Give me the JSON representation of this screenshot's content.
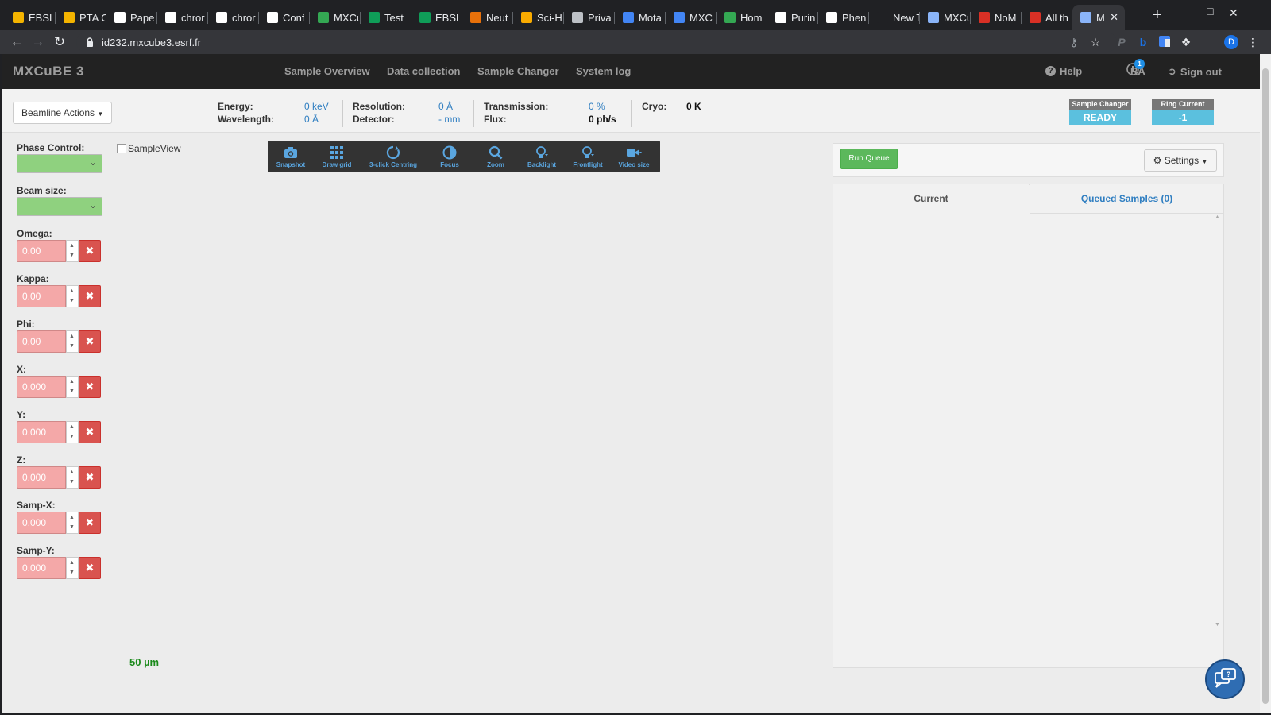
{
  "browser": {
    "tabs": [
      {
        "title": "EBSL",
        "favicon_color": "#f4b400"
      },
      {
        "title": "PTA C",
        "favicon_color": "#f4b400"
      },
      {
        "title": "Pape",
        "favicon_color": "#ffffff"
      },
      {
        "title": "chror",
        "favicon_color": "#ffffff"
      },
      {
        "title": "chror",
        "favicon_color": "#ffffff"
      },
      {
        "title": "Conf",
        "favicon_color": "#ffffff"
      },
      {
        "title": "MXCu",
        "favicon_color": "#34a853"
      },
      {
        "title": "Test",
        "favicon_color": "#0f9d58"
      },
      {
        "title": "EBSL",
        "favicon_color": "#0f9d58"
      },
      {
        "title": "Neut",
        "favicon_color": "#e8710a"
      },
      {
        "title": "Sci-H",
        "favicon_color": "#f9ab00"
      },
      {
        "title": "Priva",
        "favicon_color": "#bdc1c6"
      },
      {
        "title": "Mota",
        "favicon_color": "#4285f4"
      },
      {
        "title": "MXC",
        "favicon_color": "#4285f4"
      },
      {
        "title": "Hom",
        "favicon_color": "#34a853"
      },
      {
        "title": "Purin",
        "favicon_color": "#ffffff"
      },
      {
        "title": "Phen",
        "favicon_color": "#ffffff"
      },
      {
        "title": "New Tab",
        "favicon_color": "#202124"
      },
      {
        "title": "MXCu",
        "favicon_color": "#8ab4f8"
      },
      {
        "title": "NoM",
        "favicon_color": "#d93025"
      },
      {
        "title": "All th",
        "favicon_color": "#d93025"
      },
      {
        "title": "M",
        "favicon_color": "#8ab4f8"
      }
    ],
    "url": "id232.mxcube3.esrf.fr",
    "profile_initial": "D"
  },
  "navbar": {
    "brand": "MXCuBE 3",
    "links": [
      "Sample Overview",
      "Data collection",
      "Sample Changer",
      "System log"
    ],
    "help": "Help",
    "notifications_count": "1",
    "user": "RA",
    "sign_out": "Sign out"
  },
  "status": {
    "beamline_actions": "Beamline Actions",
    "energy_label": "Energy:",
    "energy_value": "0 keV",
    "wavelength_label": "Wavelength:",
    "wavelength_value": "0 Å",
    "resolution_label": "Resolution:",
    "resolution_value": "0 Å",
    "detector_label": "Detector:",
    "detector_value": "- mm",
    "transmission_label": "Transmission:",
    "transmission_value": "0 %",
    "flux_label": "Flux:",
    "flux_value": "0 ph/s",
    "cryo_label": "Cryo:",
    "cryo_value": "0 K",
    "sample_changer_label": "Sample Changer",
    "sample_changer_value": "READY",
    "sample_changer_color": "#5bc0de",
    "ring_current_label": "Ring Current",
    "ring_current_value": "-1",
    "ring_current_color": "#5bc0de"
  },
  "controls": {
    "phase_control_label": "Phase Control:",
    "beam_size_label": "Beam size:",
    "motors": [
      {
        "label": "Omega:",
        "value": "0.00"
      },
      {
        "label": "Kappa:",
        "value": "0.00"
      },
      {
        "label": "Phi:",
        "value": "0.00"
      },
      {
        "label": "X:",
        "value": "0.000"
      },
      {
        "label": "Y:",
        "value": "0.000"
      },
      {
        "label": "Z:",
        "value": "0.000"
      },
      {
        "label": "Samp-X:",
        "value": "0.000"
      },
      {
        "label": "Samp-Y:",
        "value": "0.000"
      }
    ]
  },
  "sample_view": {
    "image_alt": "SampleView",
    "toolbar": [
      {
        "label": "Snapshot",
        "icon": "camera-icon"
      },
      {
        "label": "Draw grid",
        "icon": "grid-icon"
      },
      {
        "label": "3-click Centring",
        "icon": "circle-icon"
      },
      {
        "label": "Focus",
        "icon": "contrast-icon"
      },
      {
        "label": "Zoom",
        "icon": "zoom-icon"
      },
      {
        "label": "Backlight",
        "icon": "lightbulb-icon"
      },
      {
        "label": "Frontlight",
        "icon": "lightbulb-icon"
      },
      {
        "label": "Video size",
        "icon": "video-icon"
      }
    ],
    "scale_label": "50 µm"
  },
  "queue": {
    "run_queue": "Run Queue",
    "settings": "Settings",
    "tab_current": "Current",
    "tab_queued": "Queued Samples (0)"
  }
}
